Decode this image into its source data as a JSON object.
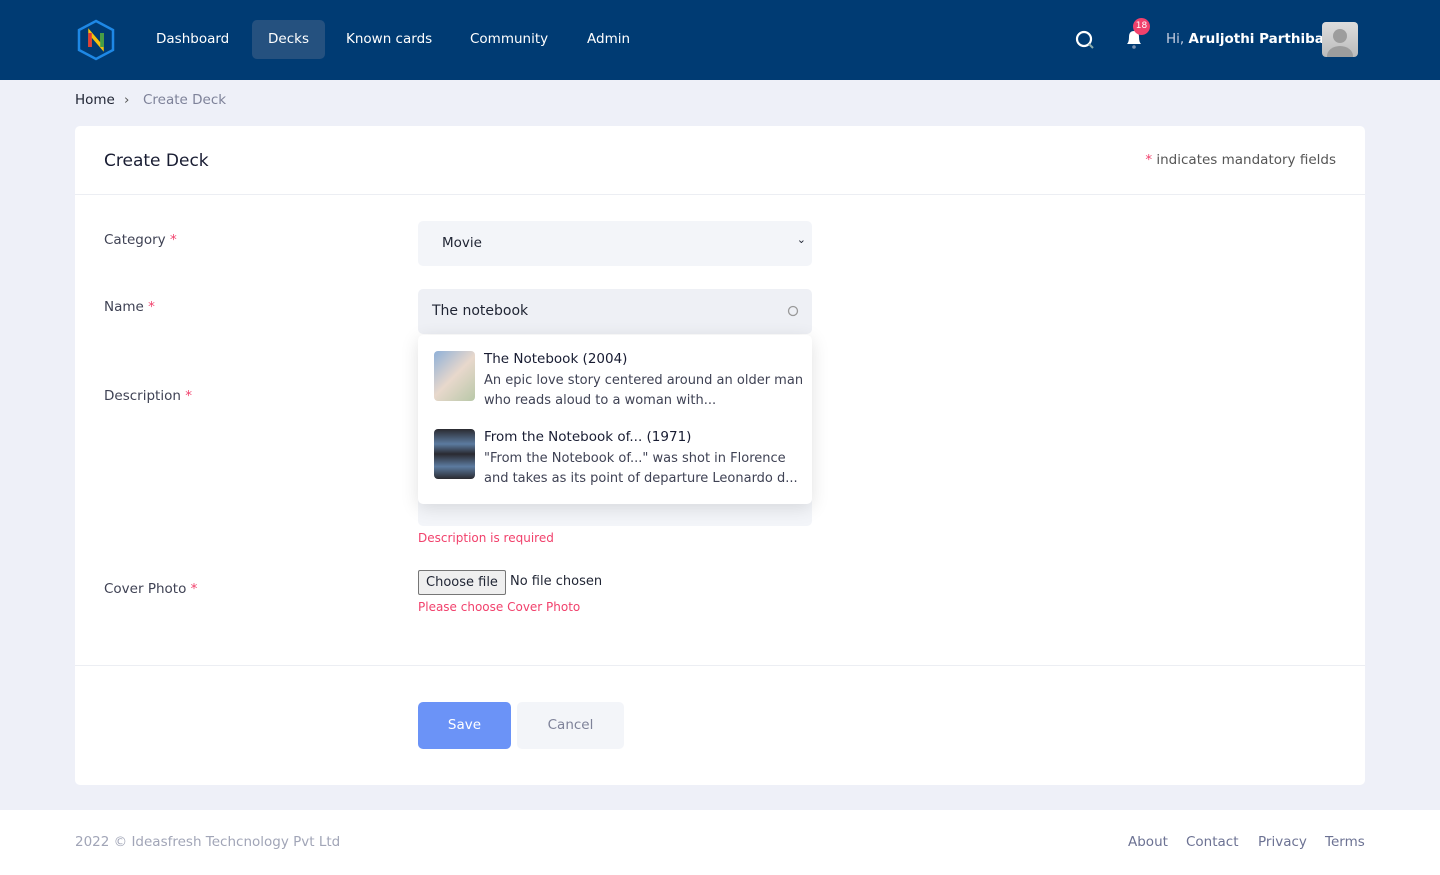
{
  "nav": {
    "items": [
      {
        "label": "Dashboard"
      },
      {
        "label": "Decks",
        "active": true
      },
      {
        "label": "Known cards"
      },
      {
        "label": "Community"
      },
      {
        "label": "Admin"
      }
    ],
    "notification_count": "18",
    "greeting": "Hi,",
    "user_name": "Aruljothi Parthiban"
  },
  "breadcrumb": {
    "home": "Home",
    "current": "Create Deck"
  },
  "form": {
    "title": "Create Deck",
    "mandatory_star": "*",
    "mandatory_note": "indicates mandatory fields",
    "category": {
      "label": "Category",
      "value": "Movie"
    },
    "name": {
      "label": "Name",
      "value": "The notebook"
    },
    "description": {
      "label": "Description",
      "error": "Description is required"
    },
    "cover": {
      "label": "Cover Photo",
      "button": "Choose file",
      "status": "No file chosen",
      "error": "Please choose Cover Photo"
    },
    "suggestions": [
      {
        "title": "The Notebook (2004)",
        "desc": "An epic love story centered around an older man who reads aloud to a woman with..."
      },
      {
        "title": "From the Notebook of... (1971)",
        "desc": "\"From the Notebook of...\" was shot in Florence and takes as its point of departure Leonardo d..."
      }
    ],
    "save": "Save",
    "cancel": "Cancel"
  },
  "footer": {
    "copyright": "2022 © Ideasfresh Techcnology Pvt Ltd",
    "links": [
      "About",
      "Contact",
      "Privacy",
      "Terms"
    ]
  },
  "colors": {
    "nav": "#003b73",
    "primary": "#6b93f7",
    "error": "#f1416c"
  }
}
